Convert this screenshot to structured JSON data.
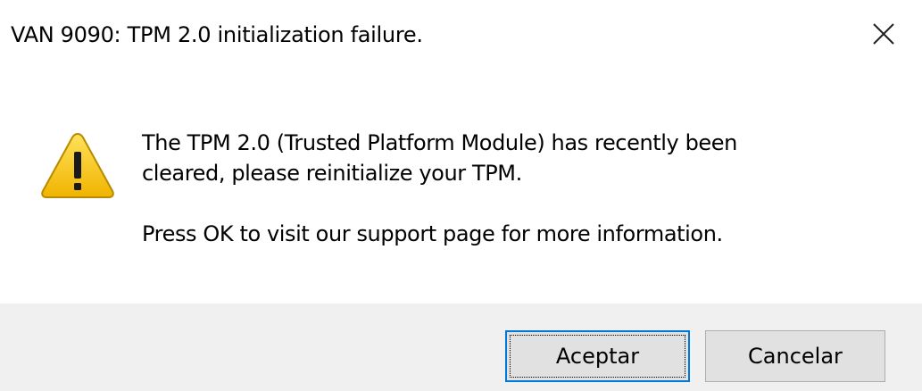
{
  "dialog": {
    "title": "VAN 9090: TPM 2.0 initialization failure.",
    "close_icon": "close-icon",
    "warning_icon": "warning-icon",
    "message_line1": "The TPM 2.0 (Trusted Platform Module) has recently been",
    "message_line2": "cleared, please reinitialize your TPM.",
    "message_para2": "Press OK to visit our support page for more information.",
    "buttons": {
      "ok_label": "Aceptar",
      "cancel_label": "Cancelar"
    },
    "colors": {
      "footer_bg": "#f0f0f0",
      "default_button_border": "#0078d7",
      "button_face": "#e1e1e1",
      "warning_yellow": "#f5c400"
    }
  }
}
